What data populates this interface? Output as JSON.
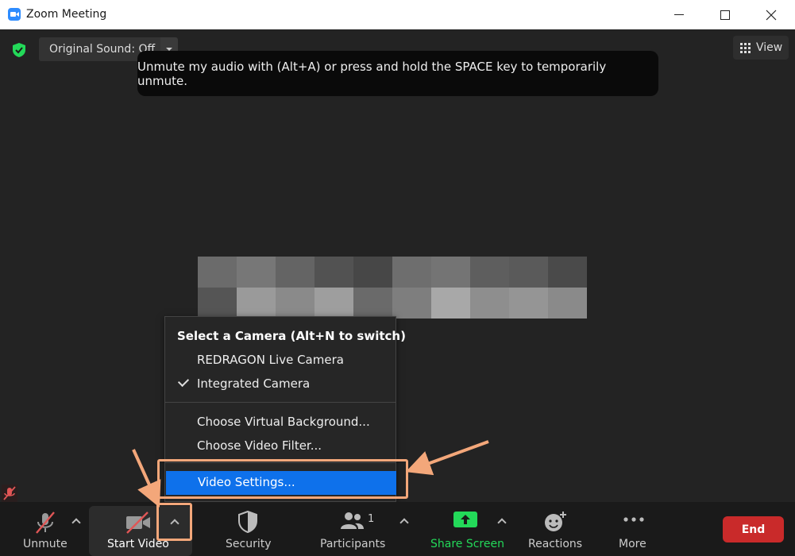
{
  "window": {
    "title": "Zoom Meeting"
  },
  "header": {
    "original_sound": "Original Sound: Off",
    "view_label": "View",
    "tooltip": "Unmute my audio with (Alt+A) or press and hold the SPACE key to temporarily unmute."
  },
  "camera_menu": {
    "heading": "Select a Camera (Alt+N to switch)",
    "cameras": [
      "REDRAGON Live Camera",
      "Integrated Camera"
    ],
    "selected_camera": "Integrated Camera",
    "options": [
      "Choose Virtual Background...",
      "Choose Video Filter..."
    ],
    "highlighted": "Video Settings..."
  },
  "toolbar": {
    "unmute": "Unmute",
    "start_video": "Start Video",
    "security": "Security",
    "participants": "Participants",
    "participants_count": "1",
    "share_screen": "Share Screen",
    "reactions": "Reactions",
    "more": "More",
    "end": "End"
  },
  "colors": {
    "share_green": "#23d959",
    "end_red": "#c92a2a",
    "highlight_blue": "#0e71eb",
    "annotation_orange": "#f3a77a",
    "secure_green": "#23d959"
  },
  "icons": [
    "zoom-app-icon",
    "shield-check-icon",
    "grid-view-icon",
    "mic-muted-icon",
    "video-off-icon",
    "security-shield-icon",
    "participants-icon",
    "share-screen-icon",
    "reactions-icon",
    "more-icon"
  ]
}
